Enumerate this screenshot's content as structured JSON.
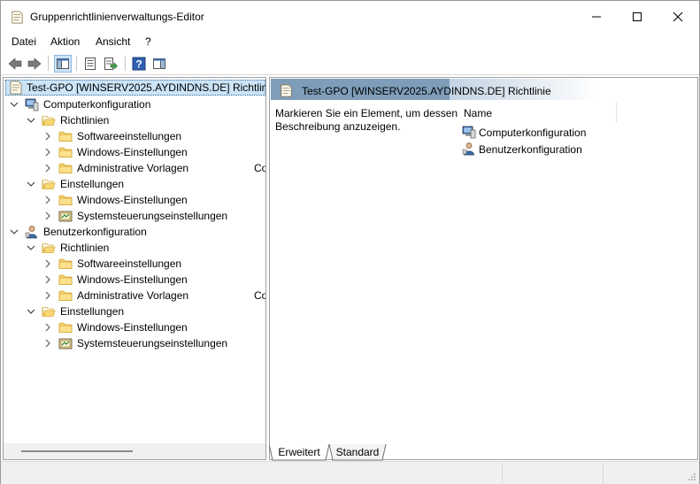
{
  "window": {
    "title": "Gruppenrichtlinienverwaltungs-Editor"
  },
  "menu": {
    "items": [
      "Datei",
      "Aktion",
      "Ansicht",
      "?"
    ]
  },
  "toolbar": {
    "buttons": [
      "back-icon",
      "forward-icon",
      "show-hide-tree-icon",
      "properties-icon",
      "export-list-icon",
      "help-icon",
      "show-hide-action-pane-icon"
    ]
  },
  "tree": {
    "root": "Test-GPO [WINSERV2025.AYDINDNS.DE] Richtlinie",
    "computer": {
      "label": "Computerkonfiguration",
      "policies": "Richtlinien",
      "software": "Softwareeinstellungen",
      "windows": "Windows-Einstellungen",
      "admin": "Administrative Vorlagen",
      "admin_clip": "Co",
      "preferences": "Einstellungen",
      "pref_windows": "Windows-Einstellungen",
      "pref_control": "Systemsteuerungseinstellungen"
    },
    "user": {
      "label": "Benutzerkonfiguration",
      "policies": "Richtlinien",
      "software": "Softwareeinstellungen",
      "windows": "Windows-Einstellungen",
      "admin": "Administrative Vorlagen",
      "admin_clip": "Co",
      "preferences": "Einstellungen",
      "pref_windows": "Windows-Einstellungen",
      "pref_control": "Systemsteuerungseinstellungen"
    }
  },
  "details": {
    "title": "Test-GPO [WINSERV2025.AYDINDNS.DE] Richtlinie",
    "description": "Markieren Sie ein Element, um dessen Beschreibung anzuzeigen.",
    "column_name": "Name",
    "items": [
      "Computerkonfiguration",
      "Benutzerkonfiguration"
    ]
  },
  "tabs": [
    "Erweitert",
    "Standard"
  ],
  "colors": {
    "selection": "#cce4f7",
    "header_band": "#7f9db9",
    "folder": "#f0c75e"
  }
}
